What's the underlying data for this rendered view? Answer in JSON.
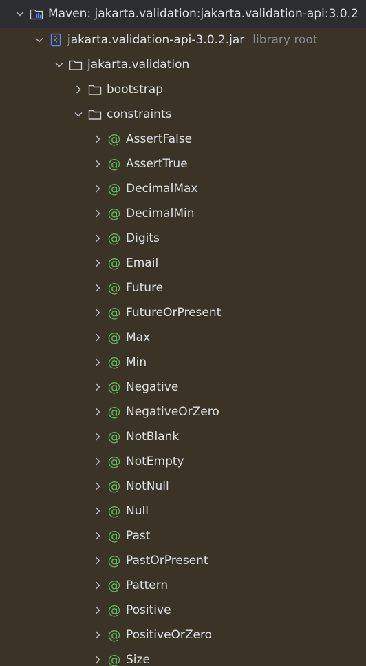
{
  "colors": {
    "background": "#3a3326",
    "text": "#dfe1e5",
    "muted": "#868a91",
    "annotation_icon": "#5fb85f",
    "jar_icon": "#548af7"
  },
  "tree": {
    "root": {
      "label": "Maven: jakarta.validation:jakarta.validation-api:3.0.2",
      "icon": "maven-library-icon",
      "expanded": true
    },
    "jar": {
      "label": "jakarta.validation-api-3.0.2.jar",
      "hint": "library root",
      "icon": "jar-icon",
      "expanded": true
    },
    "package": {
      "label": "jakarta.validation",
      "icon": "folder-icon",
      "expanded": true
    },
    "bootstrap": {
      "label": "bootstrap",
      "icon": "folder-icon",
      "expanded": false
    },
    "constraints": {
      "label": "constraints",
      "icon": "folder-icon",
      "expanded": true
    },
    "annotation_glyph": "@",
    "annotations": [
      "AssertFalse",
      "AssertTrue",
      "DecimalMax",
      "DecimalMin",
      "Digits",
      "Email",
      "Future",
      "FutureOrPresent",
      "Max",
      "Min",
      "Negative",
      "NegativeOrZero",
      "NotBlank",
      "NotEmpty",
      "NotNull",
      "Null",
      "Past",
      "PastOrPresent",
      "Pattern",
      "Positive",
      "PositiveOrZero",
      "Size"
    ]
  }
}
